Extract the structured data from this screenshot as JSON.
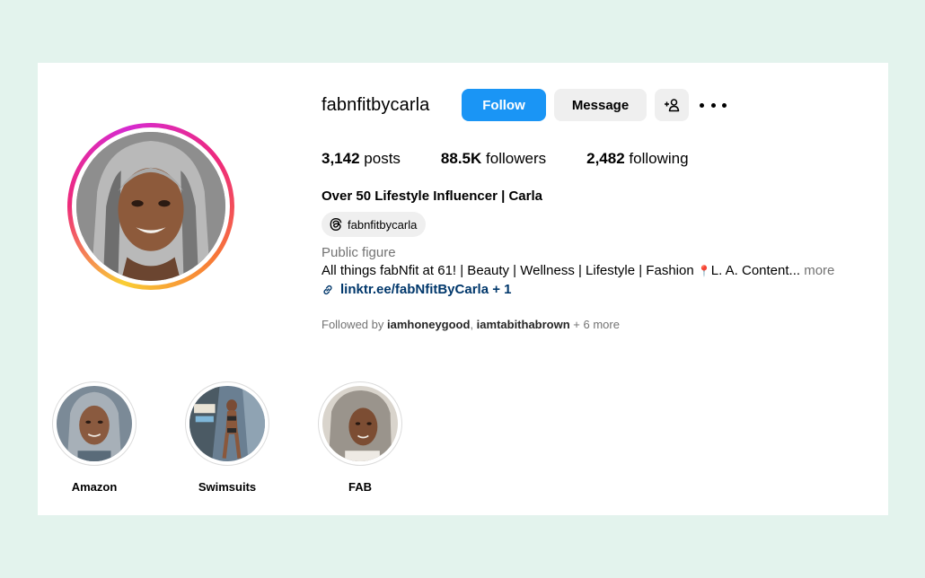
{
  "profile": {
    "username": "fabnfitbycarla",
    "full_name": "Over 50 Lifestyle Influencer | Carla",
    "threads_handle": "fabnfitbycarla",
    "category": "Public figure",
    "bio_text": "All things fabNfit at 61! | Beauty | Wellness | Lifestyle | Fashion ",
    "bio_pin": "📍",
    "bio_tail": "L. A. Content...",
    "bio_more": "more",
    "link_text": "linktr.ee/fabNfitByCarla + 1"
  },
  "actions": {
    "follow_label": "Follow",
    "message_label": "Message",
    "add_user_icon": "add-user-icon",
    "more_icon": "more-options-icon"
  },
  "stats": {
    "posts_count": "3,142",
    "posts_label": "posts",
    "followers_count": "88.5K",
    "followers_label": "followers",
    "following_count": "2,482",
    "following_label": "following"
  },
  "followed_by": {
    "prefix": "Followed by ",
    "account1": "iamhoneygood",
    "separator": ", ",
    "account2": "iamtabithabrown",
    "suffix": " + 6 more"
  },
  "highlights": [
    {
      "label": "Amazon"
    },
    {
      "label": "Swimsuits"
    },
    {
      "label": "FAB"
    }
  ],
  "colors": {
    "page_background": "#e3f3ed",
    "follow_button": "#1a95f5",
    "link": "#00376b",
    "muted_text": "#737373"
  }
}
